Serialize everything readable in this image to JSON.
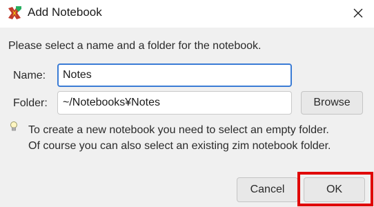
{
  "window": {
    "title": "Add Notebook",
    "app_icon": "zim-icon",
    "close_icon": "close-icon"
  },
  "dialog": {
    "intro": "Please select a name and a folder for the notebook.",
    "name_label": "Name:",
    "name_value": "Notes",
    "folder_label": "Folder:",
    "folder_value": "~/Notebooks¥Notes",
    "browse_label": "Browse",
    "hint_icon": "lightbulb-icon",
    "hint_line1": "To create a new notebook you need to select an empty folder.",
    "hint_line2": "Of course you can also select an existing zim notebook folder."
  },
  "buttons": {
    "cancel_label": "Cancel",
    "ok_label": "OK"
  },
  "colors": {
    "focus_border": "#3a7bd5",
    "highlight": "#e00000",
    "dialog_bg": "#f0f0f0"
  }
}
